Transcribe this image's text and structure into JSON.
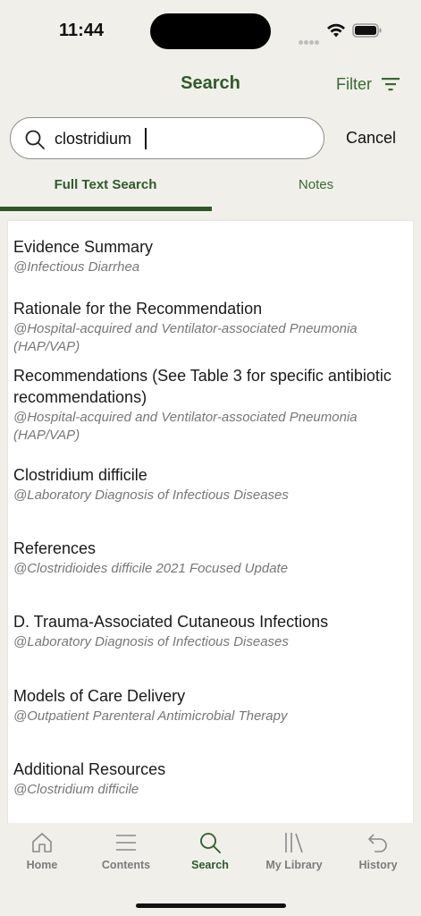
{
  "status_bar": {
    "time": "11:44"
  },
  "header": {
    "title": "Search",
    "filter_label": "Filter"
  },
  "search": {
    "value": "clostridium",
    "cancel_label": "Cancel"
  },
  "tabs": [
    {
      "label": "Full Text Search",
      "active": true
    },
    {
      "label": "Notes",
      "active": false
    }
  ],
  "results": [
    {
      "title": "Evidence Summary",
      "source": "@Infectious Diarrhea"
    },
    {
      "title": "Rationale for the Recommendation",
      "source": "@Hospital-acquired and Ventilator-associated Pneumonia (HAP/VAP)"
    },
    {
      "title": "Recommendations (See Table 3 for specific antibiotic recommendations)",
      "source": "@Hospital-acquired and Ventilator-associated Pneumonia (HAP/VAP)"
    },
    {
      "title": "Clostridium difficile",
      "source": "@Laboratory Diagnosis of Infectious Diseases"
    },
    {
      "title": "References",
      "source": "@Clostridioides difficile 2021 Focused Update"
    },
    {
      "title": "D. Trauma-Associated Cutaneous Infections",
      "source": "@Laboratory Diagnosis of Infectious Diseases"
    },
    {
      "title": "Models of Care Delivery",
      "source": "@Outpatient Parenteral Antimicrobial Therapy"
    },
    {
      "title": "Additional Resources",
      "source": "@Clostridium difficile"
    }
  ],
  "tab_bar": {
    "items": [
      {
        "label": "Home",
        "icon": "home-icon",
        "active": false
      },
      {
        "label": "Contents",
        "icon": "menu-icon",
        "active": false
      },
      {
        "label": "Search",
        "icon": "search-icon",
        "active": true
      },
      {
        "label": "My Library",
        "icon": "library-icon",
        "active": false
      },
      {
        "label": "History",
        "icon": "history-icon",
        "active": false
      }
    ]
  },
  "colors": {
    "accent": "#2f5a2a",
    "background": "#f0efea",
    "muted_text": "#777777"
  }
}
